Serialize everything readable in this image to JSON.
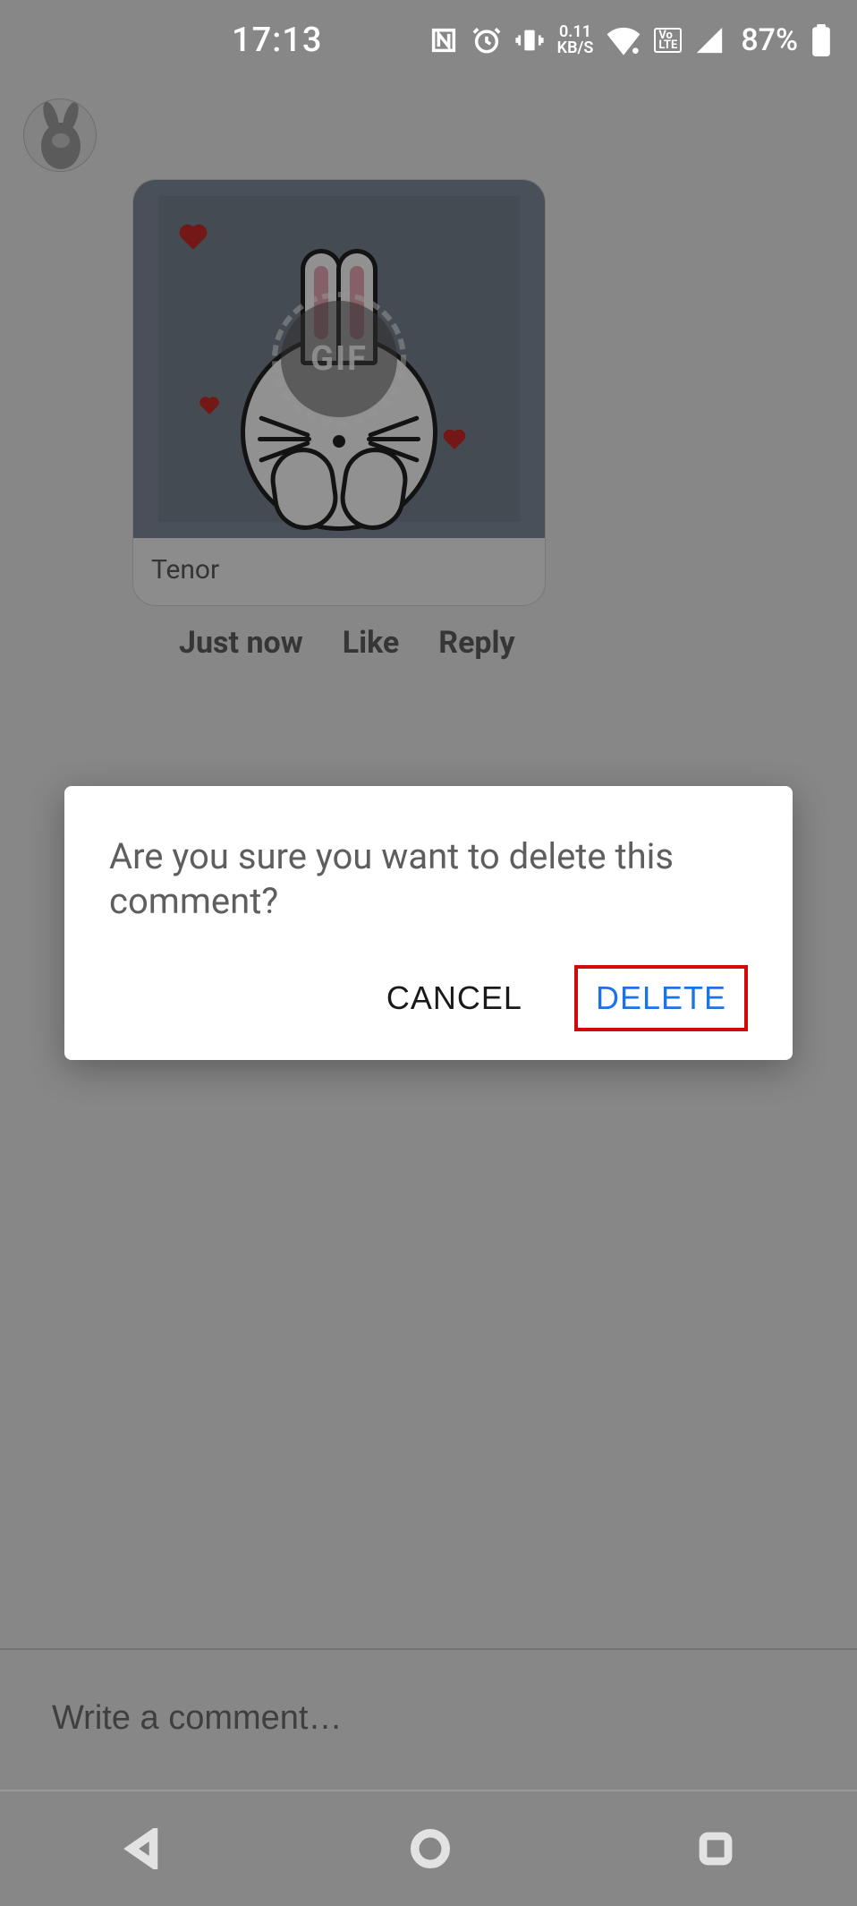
{
  "status_bar": {
    "time": "17:13",
    "data_rate": {
      "value": "0.11",
      "unit": "KB/S"
    },
    "volte": "Vo LTE",
    "battery_pct": "87%",
    "icons": [
      "nfc",
      "alarm",
      "vibrate",
      "wifi",
      "signal",
      "battery"
    ]
  },
  "comment": {
    "source": "Tenor",
    "gif_badge": "GIF",
    "actions": {
      "timestamp": "Just now",
      "like": "Like",
      "reply": "Reply"
    }
  },
  "composer": {
    "placeholder": "Write a comment…"
  },
  "dialog": {
    "message": "Are you sure you want to delete this comment?",
    "cancel": "CANCEL",
    "delete": "DELETE"
  }
}
